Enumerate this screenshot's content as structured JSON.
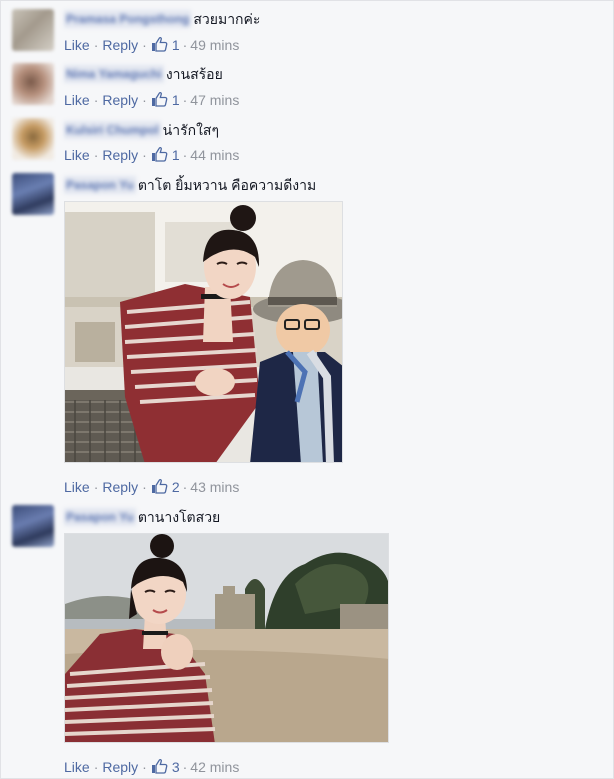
{
  "ui": {
    "like_label": "Like",
    "reply_label": "Reply",
    "like_icon": "thumbs-up-icon",
    "separator": "·",
    "link_color": "#4e69a2",
    "meta_color": "#90949c",
    "text_color": "#141823"
  },
  "comments": [
    {
      "author": "Pramasa Pongsthong",
      "text": "สวยมากค่ะ",
      "likes": "1",
      "time": "49 mins"
    },
    {
      "author": "Nima Yamaguchi",
      "text": "งานสร้อย",
      "likes": "1",
      "time": "47 mins"
    },
    {
      "author": "Kulsiri Chumpol",
      "text": "น่ารักใสๆ",
      "likes": "1",
      "time": "44 mins"
    },
    {
      "author": "Pasapon Yu",
      "text": "ตาโต ยิ้มหวาน คือความดีงาม",
      "likes": "2",
      "time": "43 mins"
    },
    {
      "author": "Pasapon Yu",
      "text": "ตานางโตสวย",
      "likes": "3",
      "time": "42 mins"
    }
  ]
}
